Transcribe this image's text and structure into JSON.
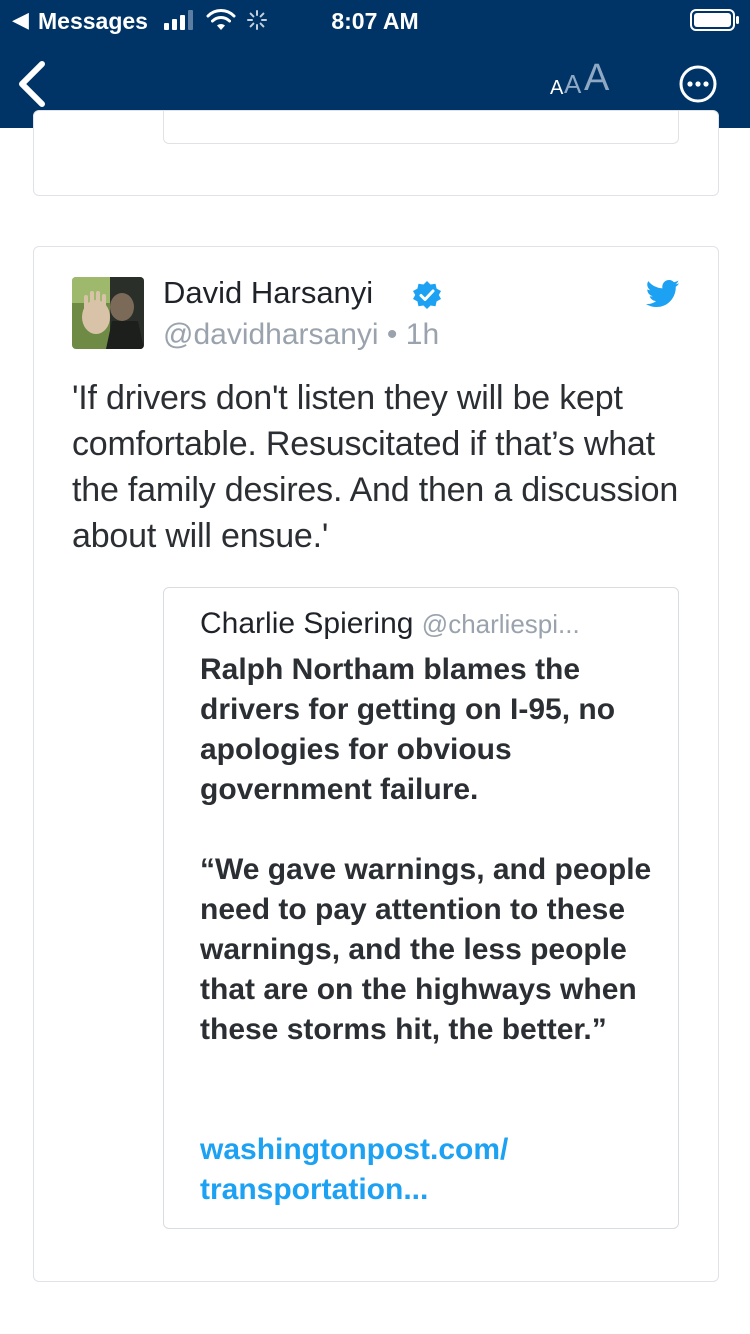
{
  "status_bar": {
    "back_glyph": "◀",
    "back_app": "Messages",
    "time": "8:07 AM",
    "icons": [
      "signal-icon",
      "wifi-icon",
      "activity-icon",
      "battery-icon"
    ]
  },
  "nav": {
    "icons": [
      "chevron-left-icon",
      "text-size-icon",
      "more-icon"
    ],
    "text_size_glyphs": [
      "A",
      "A",
      "A"
    ]
  },
  "tweet": {
    "author_name": "David Harsanyi",
    "author_handle": "@davidharsanyi",
    "separator": " • ",
    "age": "1h",
    "verified": true,
    "text": "'If drivers don't listen they will be kept comfortable. Resuscitated if that’s what the family desires. And then a discussion about will ensue.'",
    "quoted": {
      "author_name": "Charlie Spiering",
      "author_handle": "@charliespi...",
      "paragraphs": [
        "Ralph Northam blames the drivers for getting on I-95, no apologies for obvious government failure.",
        "“We gave warnings, and people need to pay attention to these warnings, and the less people that are on the highways when these storms hit, the better.”"
      ],
      "link": "washingtonpost.com/ transportation..."
    }
  },
  "colors": {
    "header_bg": "#003466",
    "link": "#1da1f2",
    "verified": "#1da1f2",
    "twitter_blue": "#1da1f2",
    "muted": "#9aa3ad"
  }
}
